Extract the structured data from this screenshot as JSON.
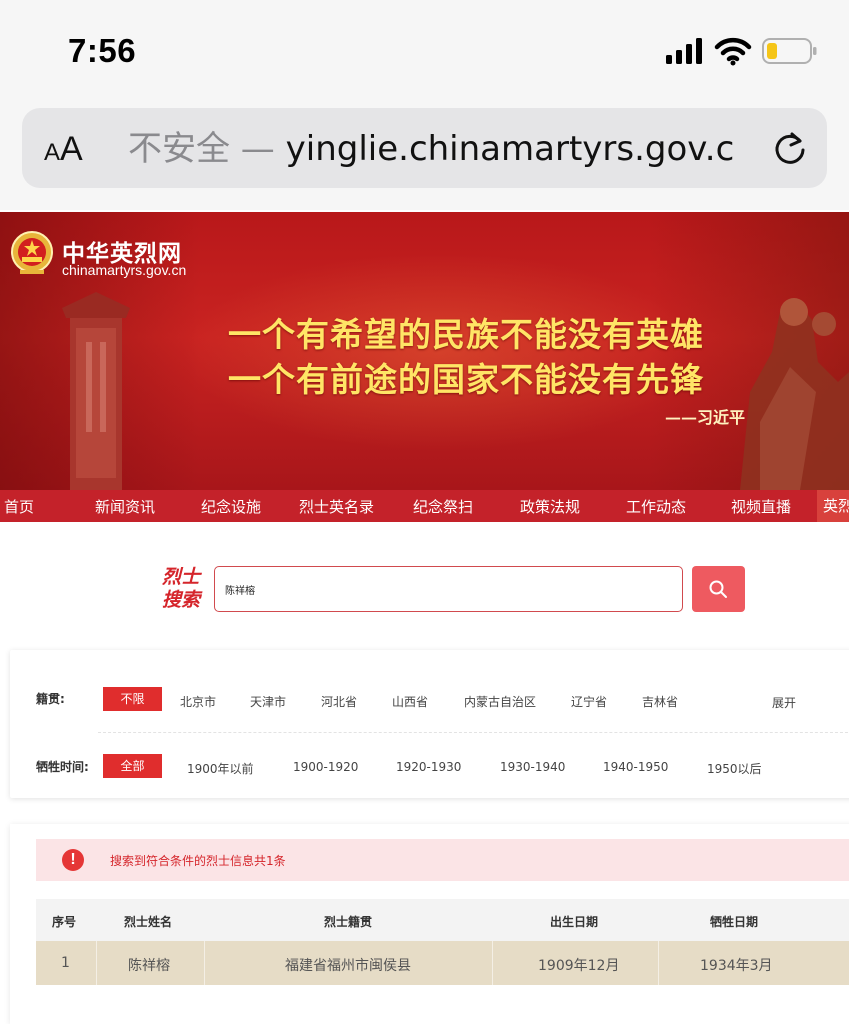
{
  "status_bar": {
    "time": "7:56"
  },
  "address_bar": {
    "text_size_button": {
      "small": "A",
      "big": "A"
    },
    "security_label": "不安全 — ",
    "domain": "yinglie.chinamartyrs.gov.c"
  },
  "banner": {
    "site_name": "中华英烈网",
    "site_domain": "chinamartyrs.gov.cn",
    "slogan_line1": "一个有希望的民族不能没有英雄",
    "slogan_line2": "一个有前途的国家不能没有先锋",
    "slogan_author": "——习近平"
  },
  "nav": {
    "items": [
      "首页",
      "新闻资讯",
      "纪念设施",
      "烈士英名录",
      "纪念祭扫",
      "政策法规",
      "工作动态",
      "视频直播",
      "英烈"
    ]
  },
  "search": {
    "logo_line1": "烈士",
    "logo_line2": "搜索",
    "query": "陈祥榕"
  },
  "filters": {
    "origin_label": "籍贯:",
    "origin_options": [
      "不限",
      "北京市",
      "天津市",
      "河北省",
      "山西省",
      "内蒙古自治区",
      "辽宁省",
      "吉林省"
    ],
    "origin_selected": "不限",
    "expand_label": "展开",
    "time_label": "牺牲时间:",
    "time_options": [
      "全部",
      "1900年以前",
      "1900-1920",
      "1920-1930",
      "1930-1940",
      "1940-1950",
      "1950以后"
    ],
    "time_selected": "全部"
  },
  "results": {
    "notice_icon": "!",
    "notice": "搜索到符合条件的烈士信息共1条",
    "columns": [
      "序号",
      "烈士姓名",
      "烈士籍贯",
      "出生日期",
      "牺牲日期"
    ],
    "rows": [
      [
        "1",
        "陈祥榕",
        "福建省福州市闽侯县",
        "1909年12月",
        "1934年3月"
      ]
    ]
  },
  "colors": {
    "brand_red": "#c4222a",
    "slogan_gold": "#ffe566",
    "active_filter": "#e02d2d",
    "search_button": "#ee5a60",
    "result_row": "#e6dcc6"
  }
}
